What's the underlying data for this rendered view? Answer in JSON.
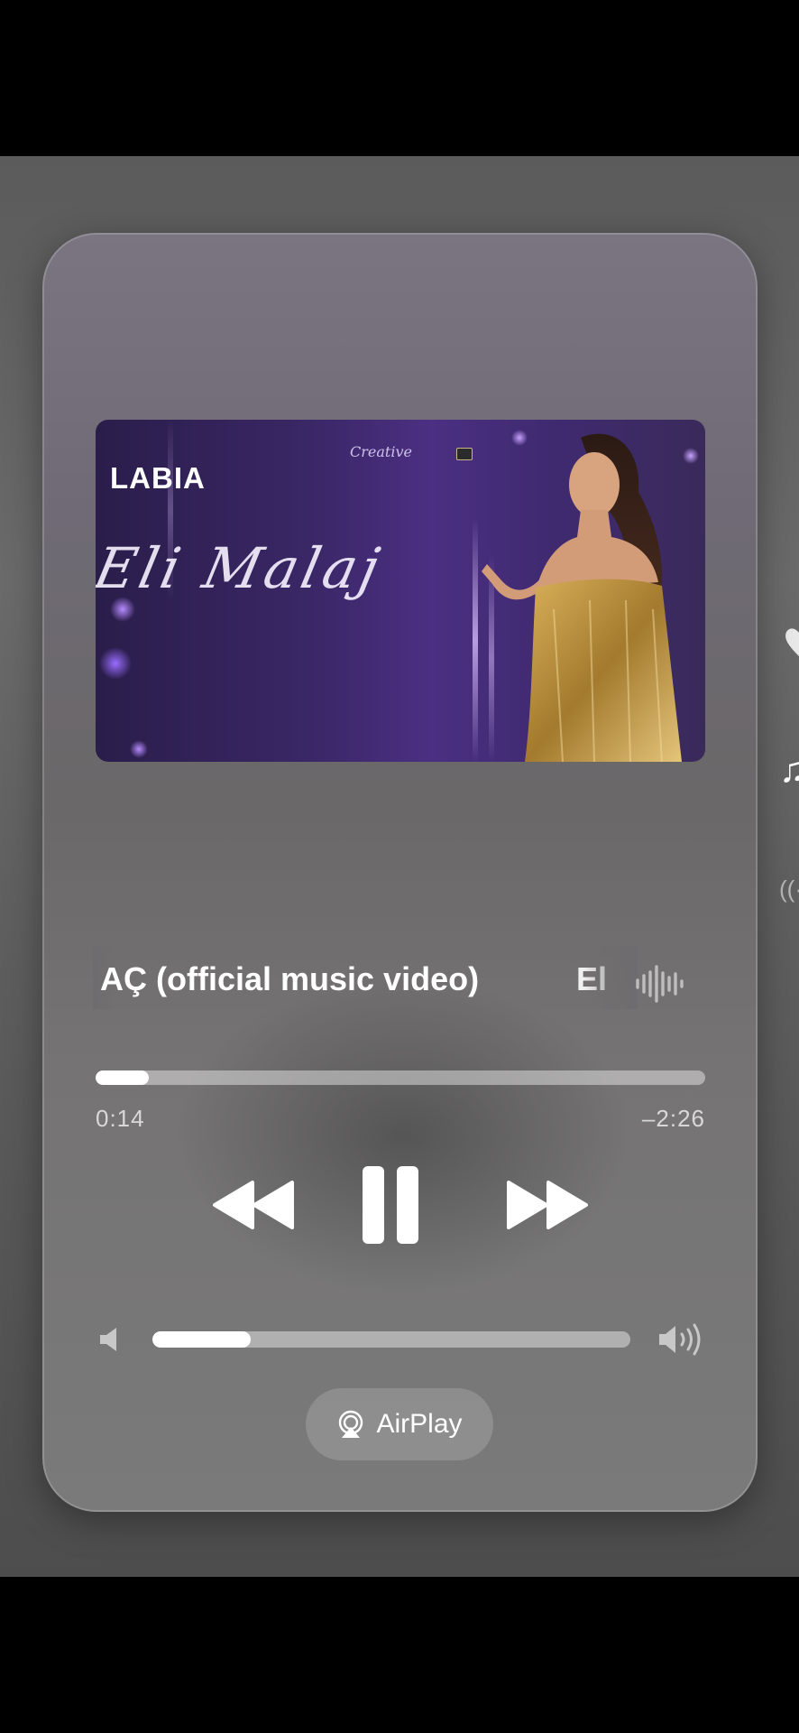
{
  "artwork": {
    "logo": "LABIA",
    "script_text": "Eli Malaj",
    "brand_mark": "Creative",
    "icon": "camera-icon"
  },
  "track": {
    "title": "AÇ  (official music video)",
    "artist": "El",
    "waveform_icon": "waveform-icon"
  },
  "playback": {
    "elapsed": "0:14",
    "remaining": "–2:26",
    "progress_fraction": 0.088
  },
  "controls": {
    "rewind_icon": "rewind-icon",
    "pause_icon": "pause-icon",
    "forward_icon": "fast-forward-icon"
  },
  "volume": {
    "level_fraction": 0.205,
    "min_icon": "speaker-low-icon",
    "max_icon": "speaker-high-icon"
  },
  "airplay": {
    "label": "AirPlay",
    "icon": "airplay-icon"
  },
  "side_panel": {
    "note_glyph": "♫",
    "broadcast_glyph": "((·"
  },
  "colors": {
    "foreground": "#ffffff",
    "artwork_purple": "#4b2f82",
    "card_gray": "#6f6a75"
  }
}
